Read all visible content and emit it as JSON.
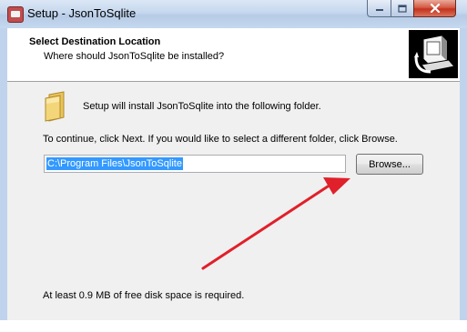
{
  "window": {
    "title": "Setup - JsonToSqlite",
    "controls": {
      "minimize": "minimize",
      "maximize": "maximize",
      "close": "close"
    }
  },
  "header": {
    "title": "Select Destination Location",
    "subtitle": "Where should JsonToSqlite be installed?"
  },
  "main": {
    "install_message": "Setup will install JsonToSqlite into the following folder.",
    "continue_message": "To continue, click Next. If you would like to select a different folder, click Browse.",
    "path_value": "C:\\Program Files\\JsonToSqlite",
    "browse_label": "Browse...",
    "disk_space_message": "At least 0.9 MB of free disk space is required."
  },
  "colors": {
    "selection": "#3399ff",
    "annotation_arrow": "#e0202a",
    "close_button": "#c4321c"
  },
  "icons": {
    "app": "setup-app-icon",
    "logo": "computer-install-icon",
    "folder": "folder-icon"
  }
}
